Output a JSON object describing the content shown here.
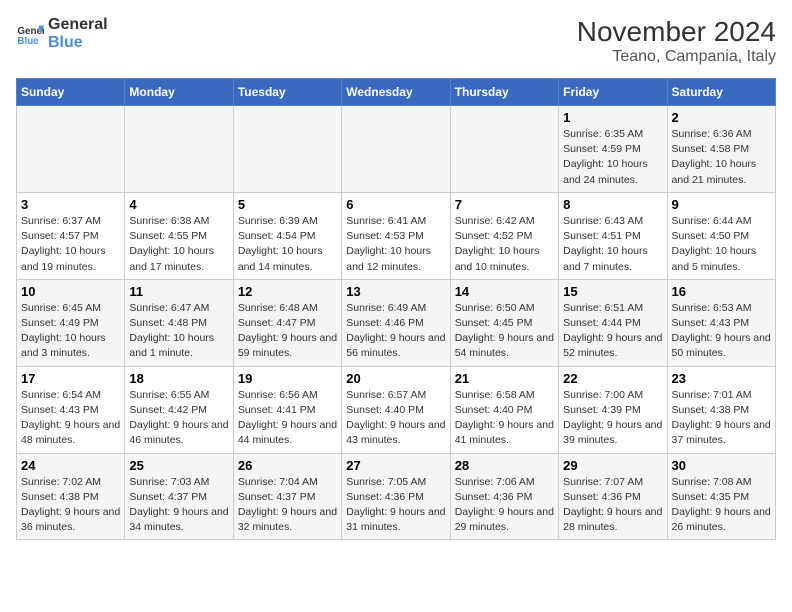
{
  "logo": {
    "line1": "General",
    "line2": "Blue"
  },
  "title": "November 2024",
  "subtitle": "Teano, Campania, Italy",
  "weekdays": [
    "Sunday",
    "Monday",
    "Tuesday",
    "Wednesday",
    "Thursday",
    "Friday",
    "Saturday"
  ],
  "weeks": [
    [
      {
        "day": "",
        "info": ""
      },
      {
        "day": "",
        "info": ""
      },
      {
        "day": "",
        "info": ""
      },
      {
        "day": "",
        "info": ""
      },
      {
        "day": "",
        "info": ""
      },
      {
        "day": "1",
        "info": "Sunrise: 6:35 AM\nSunset: 4:59 PM\nDaylight: 10 hours and 24 minutes."
      },
      {
        "day": "2",
        "info": "Sunrise: 6:36 AM\nSunset: 4:58 PM\nDaylight: 10 hours and 21 minutes."
      }
    ],
    [
      {
        "day": "3",
        "info": "Sunrise: 6:37 AM\nSunset: 4:57 PM\nDaylight: 10 hours and 19 minutes."
      },
      {
        "day": "4",
        "info": "Sunrise: 6:38 AM\nSunset: 4:55 PM\nDaylight: 10 hours and 17 minutes."
      },
      {
        "day": "5",
        "info": "Sunrise: 6:39 AM\nSunset: 4:54 PM\nDaylight: 10 hours and 14 minutes."
      },
      {
        "day": "6",
        "info": "Sunrise: 6:41 AM\nSunset: 4:53 PM\nDaylight: 10 hours and 12 minutes."
      },
      {
        "day": "7",
        "info": "Sunrise: 6:42 AM\nSunset: 4:52 PM\nDaylight: 10 hours and 10 minutes."
      },
      {
        "day": "8",
        "info": "Sunrise: 6:43 AM\nSunset: 4:51 PM\nDaylight: 10 hours and 7 minutes."
      },
      {
        "day": "9",
        "info": "Sunrise: 6:44 AM\nSunset: 4:50 PM\nDaylight: 10 hours and 5 minutes."
      }
    ],
    [
      {
        "day": "10",
        "info": "Sunrise: 6:45 AM\nSunset: 4:49 PM\nDaylight: 10 hours and 3 minutes."
      },
      {
        "day": "11",
        "info": "Sunrise: 6:47 AM\nSunset: 4:48 PM\nDaylight: 10 hours and 1 minute."
      },
      {
        "day": "12",
        "info": "Sunrise: 6:48 AM\nSunset: 4:47 PM\nDaylight: 9 hours and 59 minutes."
      },
      {
        "day": "13",
        "info": "Sunrise: 6:49 AM\nSunset: 4:46 PM\nDaylight: 9 hours and 56 minutes."
      },
      {
        "day": "14",
        "info": "Sunrise: 6:50 AM\nSunset: 4:45 PM\nDaylight: 9 hours and 54 minutes."
      },
      {
        "day": "15",
        "info": "Sunrise: 6:51 AM\nSunset: 4:44 PM\nDaylight: 9 hours and 52 minutes."
      },
      {
        "day": "16",
        "info": "Sunrise: 6:53 AM\nSunset: 4:43 PM\nDaylight: 9 hours and 50 minutes."
      }
    ],
    [
      {
        "day": "17",
        "info": "Sunrise: 6:54 AM\nSunset: 4:43 PM\nDaylight: 9 hours and 48 minutes."
      },
      {
        "day": "18",
        "info": "Sunrise: 6:55 AM\nSunset: 4:42 PM\nDaylight: 9 hours and 46 minutes."
      },
      {
        "day": "19",
        "info": "Sunrise: 6:56 AM\nSunset: 4:41 PM\nDaylight: 9 hours and 44 minutes."
      },
      {
        "day": "20",
        "info": "Sunrise: 6:57 AM\nSunset: 4:40 PM\nDaylight: 9 hours and 43 minutes."
      },
      {
        "day": "21",
        "info": "Sunrise: 6:58 AM\nSunset: 4:40 PM\nDaylight: 9 hours and 41 minutes."
      },
      {
        "day": "22",
        "info": "Sunrise: 7:00 AM\nSunset: 4:39 PM\nDaylight: 9 hours and 39 minutes."
      },
      {
        "day": "23",
        "info": "Sunrise: 7:01 AM\nSunset: 4:38 PM\nDaylight: 9 hours and 37 minutes."
      }
    ],
    [
      {
        "day": "24",
        "info": "Sunrise: 7:02 AM\nSunset: 4:38 PM\nDaylight: 9 hours and 36 minutes."
      },
      {
        "day": "25",
        "info": "Sunrise: 7:03 AM\nSunset: 4:37 PM\nDaylight: 9 hours and 34 minutes."
      },
      {
        "day": "26",
        "info": "Sunrise: 7:04 AM\nSunset: 4:37 PM\nDaylight: 9 hours and 32 minutes."
      },
      {
        "day": "27",
        "info": "Sunrise: 7:05 AM\nSunset: 4:36 PM\nDaylight: 9 hours and 31 minutes."
      },
      {
        "day": "28",
        "info": "Sunrise: 7:06 AM\nSunset: 4:36 PM\nDaylight: 9 hours and 29 minutes."
      },
      {
        "day": "29",
        "info": "Sunrise: 7:07 AM\nSunset: 4:36 PM\nDaylight: 9 hours and 28 minutes."
      },
      {
        "day": "30",
        "info": "Sunrise: 7:08 AM\nSunset: 4:35 PM\nDaylight: 9 hours and 26 minutes."
      }
    ]
  ]
}
